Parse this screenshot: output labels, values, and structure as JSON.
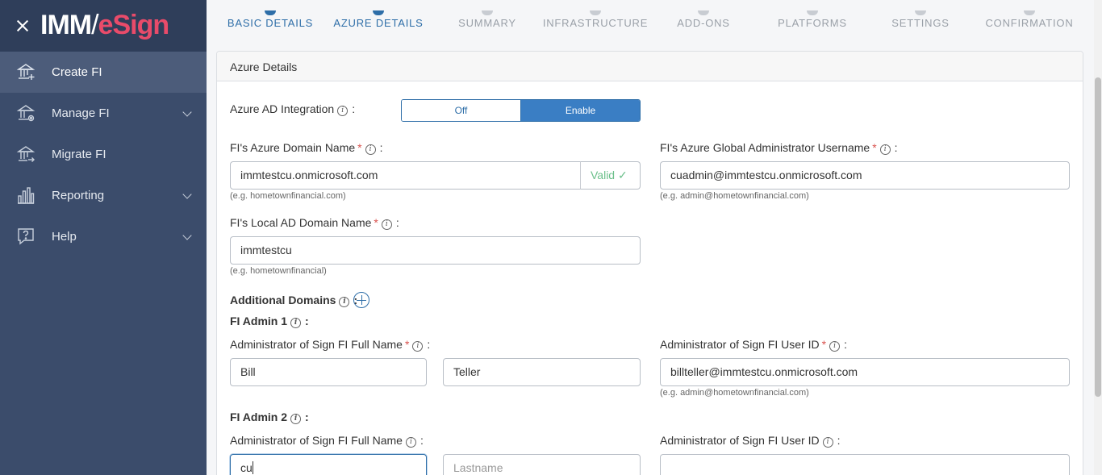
{
  "brand": {
    "imm": "IMM",
    "slash": "/",
    "esign": "eSign"
  },
  "sidebar": {
    "items": [
      {
        "label": "Create FI",
        "active": true,
        "icon": "bank-plus-icon"
      },
      {
        "label": "Manage FI",
        "expandable": true,
        "icon": "bank-gear-icon"
      },
      {
        "label": "Migrate FI",
        "icon": "bank-arrow-icon"
      },
      {
        "label": "Reporting",
        "expandable": true,
        "icon": "bar-chart-icon"
      },
      {
        "label": "Help",
        "expandable": true,
        "icon": "help-bubble-icon"
      }
    ]
  },
  "stepper": {
    "steps": [
      {
        "label": "BASIC DETAILS",
        "state": "done"
      },
      {
        "label": "AZURE DETAILS",
        "state": "active"
      },
      {
        "label": "SUMMARY",
        "state": "pending"
      },
      {
        "label": "INFRASTRUCTURE",
        "state": "pending"
      },
      {
        "label": "ADD-ONS",
        "state": "pending"
      },
      {
        "label": "PLATFORMS",
        "state": "pending"
      },
      {
        "label": "SETTINGS",
        "state": "pending"
      },
      {
        "label": "CONFIRMATION",
        "state": "pending"
      }
    ]
  },
  "form": {
    "section_title": "Azure Details",
    "azure_ad": {
      "label": "Azure AD Integration",
      "off": "Off",
      "on": "Enable",
      "selected": "Enable"
    },
    "domain": {
      "label": "FI's Azure Domain Name",
      "value": "immtestcu.onmicrosoft.com",
      "status": "Valid ✓",
      "hint": "(e.g. hometownfinancial.com)"
    },
    "global_admin": {
      "label": "FI's Azure Global Administrator Username",
      "value": "cuadmin@immtestcu.onmicrosoft.com",
      "hint": "(e.g. admin@hometownfinancial.com)"
    },
    "local_ad": {
      "label": "FI's Local AD Domain Name",
      "value": "immtestcu",
      "hint": "(e.g. hometownfinancial)"
    },
    "additional_domains": {
      "label": "Additional Domains"
    },
    "admin1": {
      "title": "FI Admin 1",
      "name_label": "Administrator of Sign FI Full Name",
      "first": "Bill",
      "last": "Teller",
      "userid_label": "Administrator of Sign FI User ID",
      "userid": "billteller@immtestcu.onmicrosoft.com",
      "hint": "(e.g. admin@hometownfinancial.com)"
    },
    "admin2": {
      "title": "FI Admin 2",
      "name_label": "Administrator of Sign FI Full Name",
      "first": "cu",
      "last_placeholder": "Lastname",
      "userid_label": "Administrator of Sign FI User ID",
      "userid": ""
    }
  },
  "colors": {
    "sidebar": "#3b4c6b",
    "accent": "#2e6ea8",
    "valid": "#6cc08b",
    "brand_pink": "#e94b6a"
  }
}
